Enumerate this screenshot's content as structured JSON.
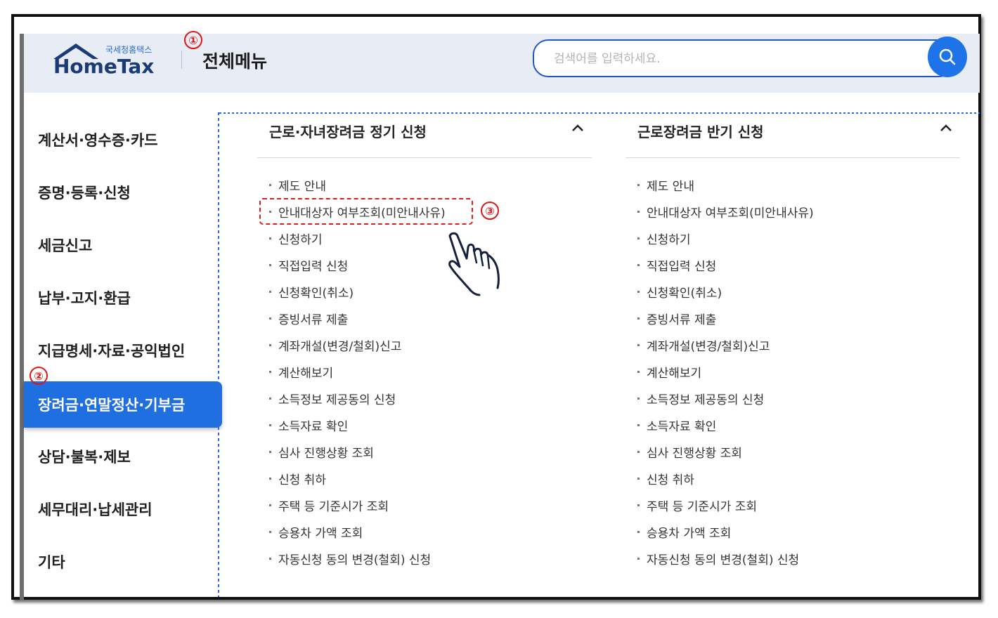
{
  "header": {
    "logo_small": "국세청홈택스",
    "logo_big": "HomeTax",
    "page_title": "전체메뉴",
    "search_placeholder": "검색어를 입력하세요."
  },
  "markers": [
    "①",
    "②",
    "③"
  ],
  "sidebar": {
    "items": [
      {
        "label": "계산서·영수증·카드"
      },
      {
        "label": "증명·등록·신청"
      },
      {
        "label": "세금신고"
      },
      {
        "label": "납부·고지·환급"
      },
      {
        "label": "지급명세·자료·공익법인"
      },
      {
        "label": "장려금·연말정산·기부금",
        "active": true
      },
      {
        "label": "상담·불복·제보"
      },
      {
        "label": "세무대리·납세관리"
      },
      {
        "label": "기타"
      }
    ]
  },
  "columns": [
    {
      "title": "근로·자녀장려금 정기 신청",
      "items": [
        "제도 안내",
        "안내대상자 여부조회(미안내사유)",
        "신청하기",
        "직접입력 신청",
        "신청확인(취소)",
        "증빙서류 제출",
        "계좌개설(변경/철회)신고",
        "계산해보기",
        "소득정보 제공동의 신청",
        "소득자료 확인",
        "심사 진행상황 조회",
        "신청 취하",
        "주택 등 기준시가 조회",
        "승용차 가액 조회",
        "자동신청 동의 변경(철회) 신청"
      ]
    },
    {
      "title": "근로장려금 반기 신청",
      "items": [
        "제도 안내",
        "안내대상자 여부조회(미안내사유)",
        "신청하기",
        "직접입력 신청",
        "신청확인(취소)",
        "증빙서류 제출",
        "계좌개설(변경/철회)신고",
        "계산해보기",
        "소득정보 제공동의 신청",
        "소득자료 확인",
        "심사 진행상황 조회",
        "신청 취하",
        "주택 등 기준시가 조회",
        "승용차 가액 조회",
        "자동신청 동의 변경(철회) 신청"
      ]
    }
  ],
  "colors": {
    "accent": "#1f6fe0",
    "search_border": "#1f57c9",
    "marker": "#d81919",
    "logo_text": "#1b3b77"
  }
}
